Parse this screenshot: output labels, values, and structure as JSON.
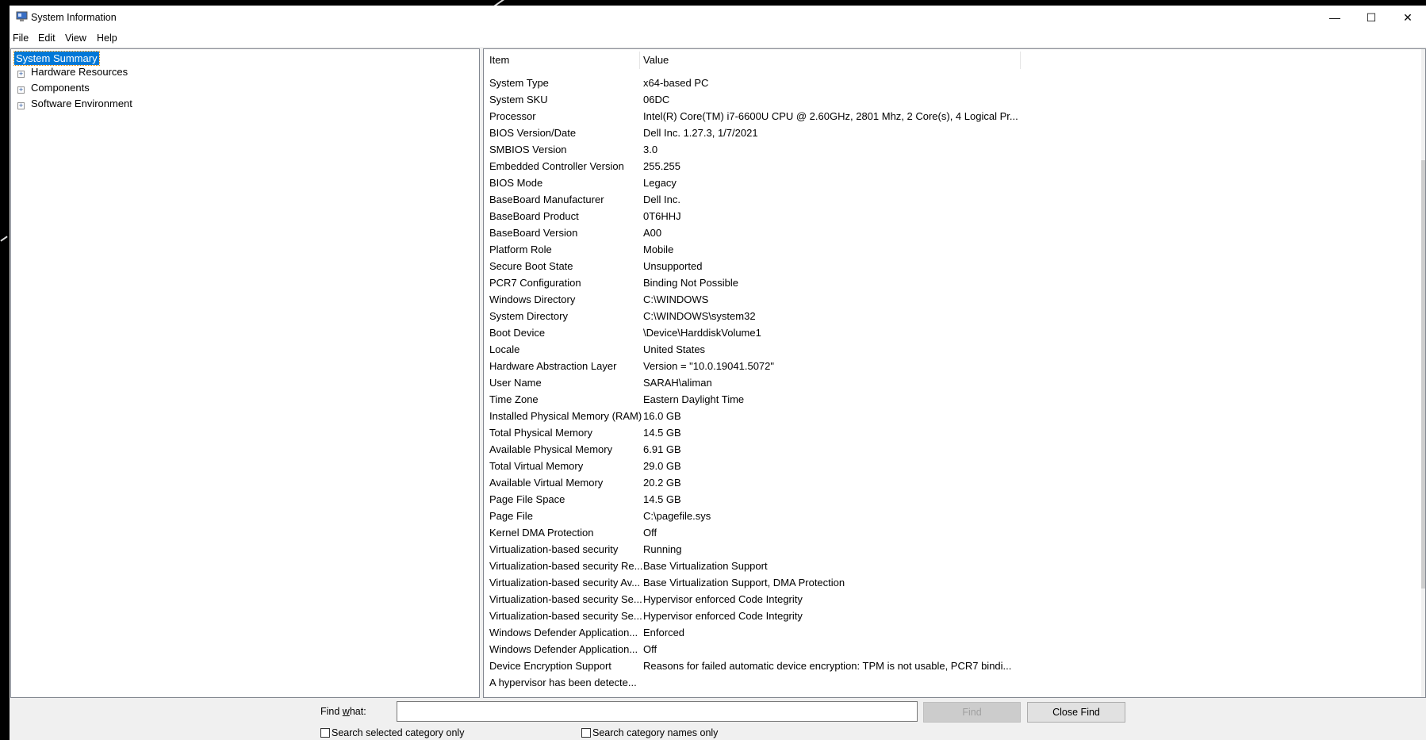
{
  "window": {
    "title": "System Information",
    "minimize": "—",
    "maximize": "☐",
    "close": "✕"
  },
  "menu": [
    "File",
    "Edit",
    "View",
    "Help"
  ],
  "tree": {
    "selected": "System Summary",
    "nodes": [
      "Hardware Resources",
      "Components",
      "Software Environment"
    ],
    "expander": "+"
  },
  "list": {
    "headers": {
      "item": "Item",
      "value": "Value"
    },
    "rows": [
      [
        "System Type",
        "x64-based PC"
      ],
      [
        "System SKU",
        "06DC"
      ],
      [
        "Processor",
        "Intel(R) Core(TM) i7-6600U CPU @ 2.60GHz, 2801 Mhz, 2 Core(s), 4 Logical Pr..."
      ],
      [
        "BIOS Version/Date",
        "Dell Inc. 1.27.3, 1/7/2021"
      ],
      [
        "SMBIOS Version",
        "3.0"
      ],
      [
        "Embedded Controller Version",
        "255.255"
      ],
      [
        "BIOS Mode",
        "Legacy"
      ],
      [
        "BaseBoard Manufacturer",
        "Dell Inc."
      ],
      [
        "BaseBoard Product",
        "0T6HHJ"
      ],
      [
        "BaseBoard Version",
        "A00"
      ],
      [
        "Platform Role",
        "Mobile"
      ],
      [
        "Secure Boot State",
        "Unsupported"
      ],
      [
        "PCR7 Configuration",
        "Binding Not Possible"
      ],
      [
        "Windows Directory",
        "C:\\WINDOWS"
      ],
      [
        "System Directory",
        "C:\\WINDOWS\\system32"
      ],
      [
        "Boot Device",
        "\\Device\\HarddiskVolume1"
      ],
      [
        "Locale",
        "United States"
      ],
      [
        "Hardware Abstraction Layer",
        "Version = \"10.0.19041.5072\""
      ],
      [
        "User Name",
        "SARAH\\aliman"
      ],
      [
        "Time Zone",
        "Eastern Daylight Time"
      ],
      [
        "Installed Physical Memory (RAM)",
        "16.0 GB"
      ],
      [
        "Total Physical Memory",
        "14.5 GB"
      ],
      [
        "Available Physical Memory",
        "6.91 GB"
      ],
      [
        "Total Virtual Memory",
        "29.0 GB"
      ],
      [
        "Available Virtual Memory",
        "20.2 GB"
      ],
      [
        "Page File Space",
        "14.5 GB"
      ],
      [
        "Page File",
        "C:\\pagefile.sys"
      ],
      [
        "Kernel DMA Protection",
        "Off"
      ],
      [
        "Virtualization-based security",
        "Running"
      ],
      [
        "Virtualization-based security Re...",
        "Base Virtualization Support"
      ],
      [
        "Virtualization-based security Av...",
        "Base Virtualization Support, DMA Protection"
      ],
      [
        "Virtualization-based security Se...",
        "Hypervisor enforced Code Integrity"
      ],
      [
        "Virtualization-based security Se...",
        "Hypervisor enforced Code Integrity"
      ],
      [
        "Windows Defender Application...",
        "Enforced"
      ],
      [
        "Windows Defender Application...",
        "Off"
      ],
      [
        "Device Encryption Support",
        "Reasons for failed automatic device encryption: TPM is not usable, PCR7 bindi..."
      ],
      [
        "A hypervisor has been detecte...",
        ""
      ]
    ]
  },
  "find": {
    "label": "Find what:",
    "value": "",
    "find_button": "Find",
    "close_button": "Close Find",
    "check1": "Search selected category only",
    "check2": "Search category names only"
  }
}
